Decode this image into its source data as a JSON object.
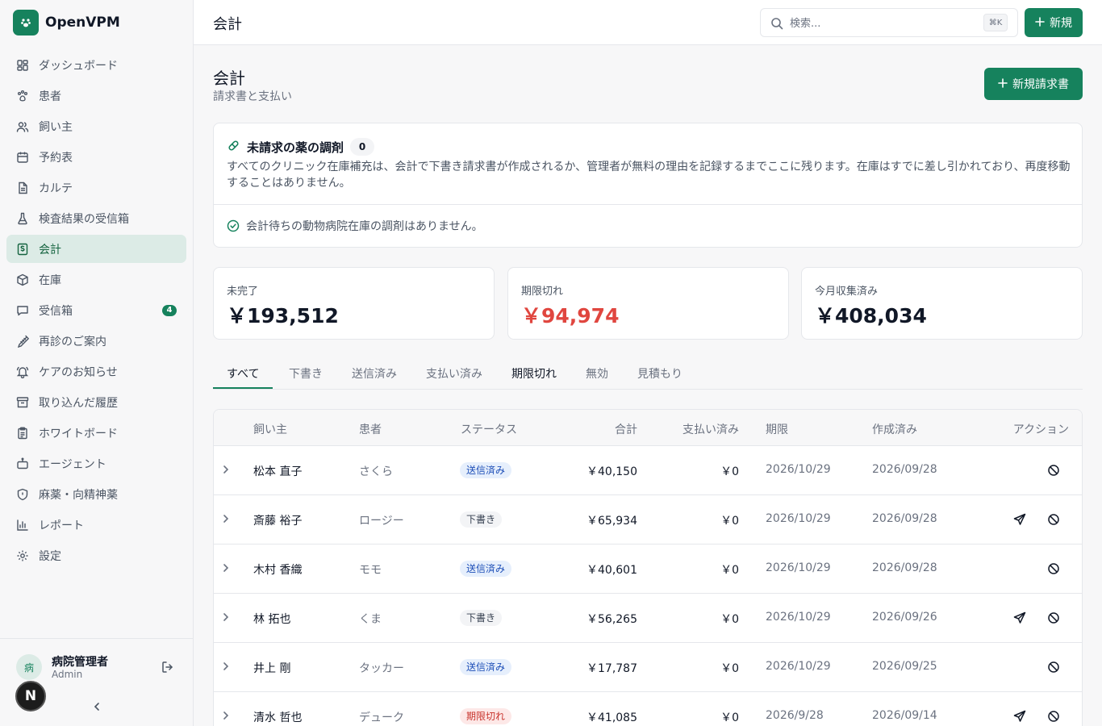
{
  "app": {
    "name": "OpenVPM"
  },
  "sidebar": {
    "items": [
      {
        "label": "ダッシュボード",
        "icon": "dashboard-icon"
      },
      {
        "label": "患者",
        "icon": "paw-icon"
      },
      {
        "label": "飼い主",
        "icon": "users-icon"
      },
      {
        "label": "予約表",
        "icon": "calendar-icon"
      },
      {
        "label": "カルテ",
        "icon": "document-icon"
      },
      {
        "label": "検査結果の受信箱",
        "icon": "flask-icon"
      },
      {
        "label": "会計",
        "icon": "billing-icon",
        "active": true
      },
      {
        "label": "在庫",
        "icon": "box-icon"
      },
      {
        "label": "受信箱",
        "icon": "message-icon",
        "badge": "4"
      },
      {
        "label": "再診のご案内",
        "icon": "syringe-icon"
      },
      {
        "label": "ケアのお知らせ",
        "icon": "bell-icon"
      },
      {
        "label": "取り込んだ履歴",
        "icon": "archive-icon"
      },
      {
        "label": "ホワイトボード",
        "icon": "clipboard-icon"
      },
      {
        "label": "エージェント",
        "icon": "bot-icon"
      },
      {
        "label": "麻薬・向精神薬",
        "icon": "shield-icon"
      },
      {
        "label": "レポート",
        "icon": "bar-chart-icon"
      },
      {
        "label": "設定",
        "icon": "gear-icon"
      }
    ],
    "user": {
      "avatar": "病",
      "name": "病院管理者",
      "role": "Admin"
    },
    "fab": "N"
  },
  "topbar": {
    "title": "会計",
    "search_placeholder": "検索...",
    "shortcut": "⌘K",
    "new_label": "新規"
  },
  "page": {
    "title": "会計",
    "subtitle": "請求書と支払い",
    "new_invoice_label": "新規請求書"
  },
  "unbilled": {
    "title": "未請求の薬の調剤",
    "count": "0",
    "description": "すべてのクリニック在庫補充は、会計で下書き請求書が作成されるか、管理者が無料の理由を記録するまでここに残ります。在庫はすでに差し引かれており、再度移動することはありません。",
    "empty_message": "会計待ちの動物病院在庫の調剤はありません。"
  },
  "stats": [
    {
      "label": "未完了",
      "value": "￥193,512",
      "color": "#111827"
    },
    {
      "label": "期限切れ",
      "value": "￥94,974",
      "color": "#e0463f"
    },
    {
      "label": "今月収集済み",
      "value": "￥408,034",
      "color": "#111827"
    }
  ],
  "tabs": [
    "すべて",
    "下書き",
    "送信済み",
    "支払い済み",
    "期限切れ",
    "無効",
    "見積もり"
  ],
  "table": {
    "headers": [
      "飼い主",
      "患者",
      "ステータス",
      "合計",
      "支払い済み",
      "期限",
      "作成済み",
      "アクション"
    ],
    "rows": [
      {
        "owner": "松本 直子",
        "patient": "さくら",
        "status": "送信済み",
        "status_kind": "sent",
        "total": "￥40,150",
        "paid": "￥0",
        "due": "2026/10/29",
        "created": "2026/09/28",
        "can_send": false
      },
      {
        "owner": "斎藤 裕子",
        "patient": "ロージー",
        "status": "下書き",
        "status_kind": "draft",
        "total": "￥65,934",
        "paid": "￥0",
        "due": "2026/10/29",
        "created": "2026/09/28",
        "can_send": true
      },
      {
        "owner": "木村 香織",
        "patient": "モモ",
        "status": "送信済み",
        "status_kind": "sent",
        "total": "￥40,601",
        "paid": "￥0",
        "due": "2026/10/29",
        "created": "2026/09/28",
        "can_send": false
      },
      {
        "owner": "林 拓也",
        "patient": "くま",
        "status": "下書き",
        "status_kind": "draft",
        "total": "￥56,265",
        "paid": "￥0",
        "due": "2026/10/29",
        "created": "2026/09/26",
        "can_send": true
      },
      {
        "owner": "井上 剛",
        "patient": "タッカー",
        "status": "送信済み",
        "status_kind": "sent",
        "total": "￥17,787",
        "paid": "￥0",
        "due": "2026/10/29",
        "created": "2026/09/25",
        "can_send": false
      },
      {
        "owner": "清水 哲也",
        "patient": "デューク",
        "status": "期限切れ",
        "status_kind": "overdue",
        "total": "￥41,085",
        "paid": "￥0",
        "due": "2026/9/28",
        "created": "2026/09/14",
        "can_send": true
      }
    ]
  }
}
